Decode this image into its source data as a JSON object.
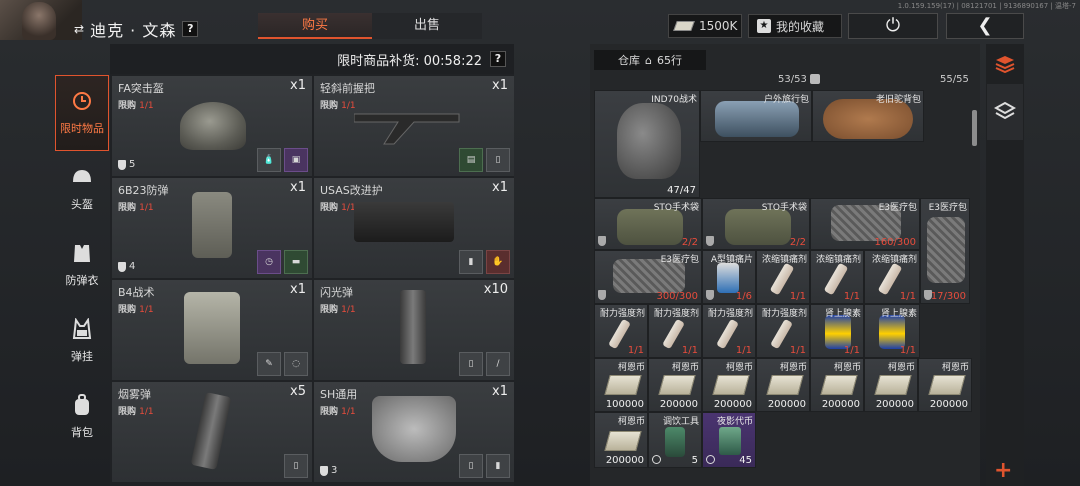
{
  "header": {
    "player_name": "迪克 · 文森",
    "help": "?",
    "tabs": [
      {
        "label": "购买"
      },
      {
        "label": "出售"
      }
    ],
    "currency_amount": "1500K",
    "favorites_label": "我的收藏",
    "version_text": "1.0.159.159(17) | 08121701 | 9136890167 | 温塔-7"
  },
  "shop": {
    "restock_label": "限时商品补货: 00:58:22",
    "items": [
      {
        "name": "FA突击盔",
        "limit_prefix": "限购 ",
        "limit": "1/1",
        "qty": "x1",
        "durability": "5"
      },
      {
        "name": "轻斜前握把",
        "limit_prefix": "限购 ",
        "limit": "1/1",
        "qty": "x1"
      },
      {
        "name": "6B23防弹",
        "limit_prefix": "限购 ",
        "limit": "1/1",
        "qty": "x1",
        "durability": "4"
      },
      {
        "name": "USAS改进护",
        "limit_prefix": "限购 ",
        "limit": "1/1",
        "qty": "x1"
      },
      {
        "name": "B4战术",
        "limit_prefix": "限购 ",
        "limit": "1/1",
        "qty": "x1"
      },
      {
        "name": "闪光弹",
        "limit_prefix": "限购 ",
        "limit": "1/1",
        "qty": "x10"
      },
      {
        "name": "烟雾弹",
        "limit_prefix": "限购 ",
        "limit": "1/1",
        "qty": "x5"
      },
      {
        "name": "SH通用",
        "limit_prefix": "限购 ",
        "limit": "1/1",
        "qty": "x1",
        "durability": "3"
      }
    ]
  },
  "categories": [
    {
      "label": "限时物品",
      "icon": "clock-icon"
    },
    {
      "label": "头盔",
      "icon": "helmet-icon"
    },
    {
      "label": "防弹衣",
      "icon": "vest-icon"
    },
    {
      "label": "弹挂",
      "icon": "rig-icon"
    },
    {
      "label": "背包",
      "icon": "backpack-icon"
    }
  ],
  "warehouse": {
    "label": "仓库",
    "rows": "65行",
    "cap1": "53/53",
    "cap2": "55/55",
    "slots": {
      "ind70": {
        "name": "IND70战术",
        "count": "47/47"
      },
      "travel_bag": {
        "name": "户外旅行包"
      },
      "camel_bag": {
        "name": "老旧驼背包"
      },
      "sto1": {
        "name": "STO手术袋",
        "count": "2/2"
      },
      "sto2": {
        "name": "STO手术袋",
        "count": "2/2"
      },
      "e3a": {
        "name": "E3医疗包",
        "count": "160/300"
      },
      "e3b": {
        "name": "E3医疗包",
        "count": "217/300"
      },
      "e3c": {
        "name": "E3医疗包",
        "count": "300/300"
      },
      "painkiller": {
        "name": "A型镇痛片",
        "count": "1/6"
      },
      "conc1": {
        "name": "浓缩镇痛剂",
        "count": "1/1"
      },
      "conc2": {
        "name": "浓缩镇痛剂",
        "count": "1/1"
      },
      "conc3": {
        "name": "浓缩镇痛剂",
        "count": "1/1"
      },
      "stam1": {
        "name": "耐力强度剂",
        "count": "1/1"
      },
      "stam2": {
        "name": "耐力强度剂",
        "count": "1/1"
      },
      "stam3": {
        "name": "耐力强度剂",
        "count": "1/1"
      },
      "stam4": {
        "name": "耐力强度剂",
        "count": "1/1"
      },
      "adr1": {
        "name": "肾上腺素",
        "count": "1/1"
      },
      "adr2": {
        "name": "肾上腺素",
        "count": "1/1"
      },
      "coin1": {
        "name": "柯恩币",
        "count": "100000"
      },
      "coin2": {
        "name": "柯恩币",
        "count": "200000"
      },
      "coin3": {
        "name": "柯恩币",
        "count": "200000"
      },
      "coin4": {
        "name": "柯恩币",
        "count": "200000"
      },
      "coin5": {
        "name": "柯恩币",
        "count": "200000"
      },
      "coin6": {
        "name": "柯恩币",
        "count": "200000"
      },
      "coin7": {
        "name": "柯恩币",
        "count": "200000"
      },
      "coin8": {
        "name": "柯恩币",
        "count": "200000"
      },
      "drink": {
        "name": "调饮工具",
        "count": "5"
      },
      "night": {
        "name": "夜影代币",
        "count": "45"
      }
    }
  }
}
